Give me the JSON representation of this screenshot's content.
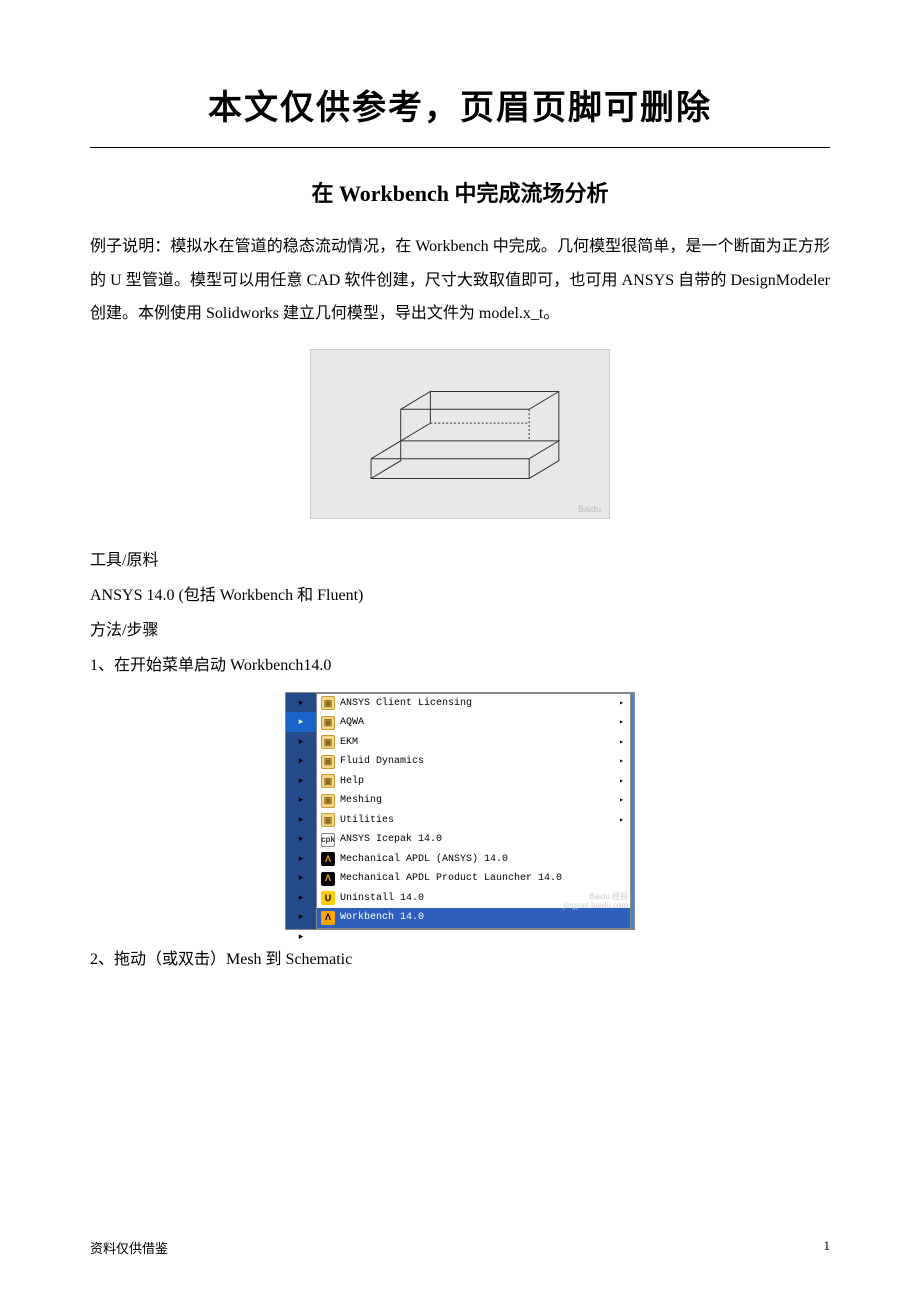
{
  "header_note": "本文仅供参考，页眉页脚可删除",
  "title": "在 Workbench 中完成流场分析",
  "intro_paragraph": "例子说明：模拟水在管道的稳态流动情况，在 Workbench 中完成。几何模型很简单，是一个断面为正方形的 U 型管道。模型可以用任意 CAD 软件创建，尺寸大致取值即可，也可用 ANSYS 自带的 DesignModeler 创建。本例使用 Solidworks 建立几何模型，导出文件为 model.x_t。",
  "sections": {
    "tools_label": "工具/原料",
    "tools_content": "ANSYS 14.0 (包括 Workbench 和 Fluent)",
    "method_label": "方法/步骤",
    "step1": "1、在开始菜单启动 Workbench14.0",
    "step2": "2、拖动（或双击）Mesh 到 Schematic"
  },
  "menu": {
    "items": [
      {
        "icon": "folder",
        "label": "ANSYS Client Licensing",
        "submenu": true,
        "hl": false
      },
      {
        "icon": "folder",
        "label": "AQWA",
        "submenu": true,
        "hl": false
      },
      {
        "icon": "folder",
        "label": "EKM",
        "submenu": true,
        "hl": false
      },
      {
        "icon": "folder",
        "label": "Fluid Dynamics",
        "submenu": true,
        "hl": false
      },
      {
        "icon": "folder",
        "label": "Help",
        "submenu": true,
        "hl": false
      },
      {
        "icon": "folder",
        "label": "Meshing",
        "submenu": true,
        "hl": false
      },
      {
        "icon": "folder",
        "label": "Utilities",
        "submenu": true,
        "hl": false
      },
      {
        "icon": "app",
        "label": "ANSYS Icepak 14.0",
        "submenu": false,
        "hl": false
      },
      {
        "icon": "lambda",
        "label": "Mechanical APDL (ANSYS) 14.0",
        "submenu": false,
        "hl": false
      },
      {
        "icon": "lambda",
        "label": "Mechanical APDL Product Launcher 14.0",
        "submenu": false,
        "hl": false
      },
      {
        "icon": "uninst",
        "label": "Uninstall 14.0",
        "submenu": false,
        "hl": false
      },
      {
        "icon": "lambda-o",
        "label": "Workbench 14.0",
        "submenu": false,
        "hl": true
      }
    ],
    "watermark_top": "Baidu 经验",
    "watermark_bottom": "jingyan.baidu.com"
  },
  "footer": {
    "left": "资料仅供借鉴",
    "right": "1"
  }
}
